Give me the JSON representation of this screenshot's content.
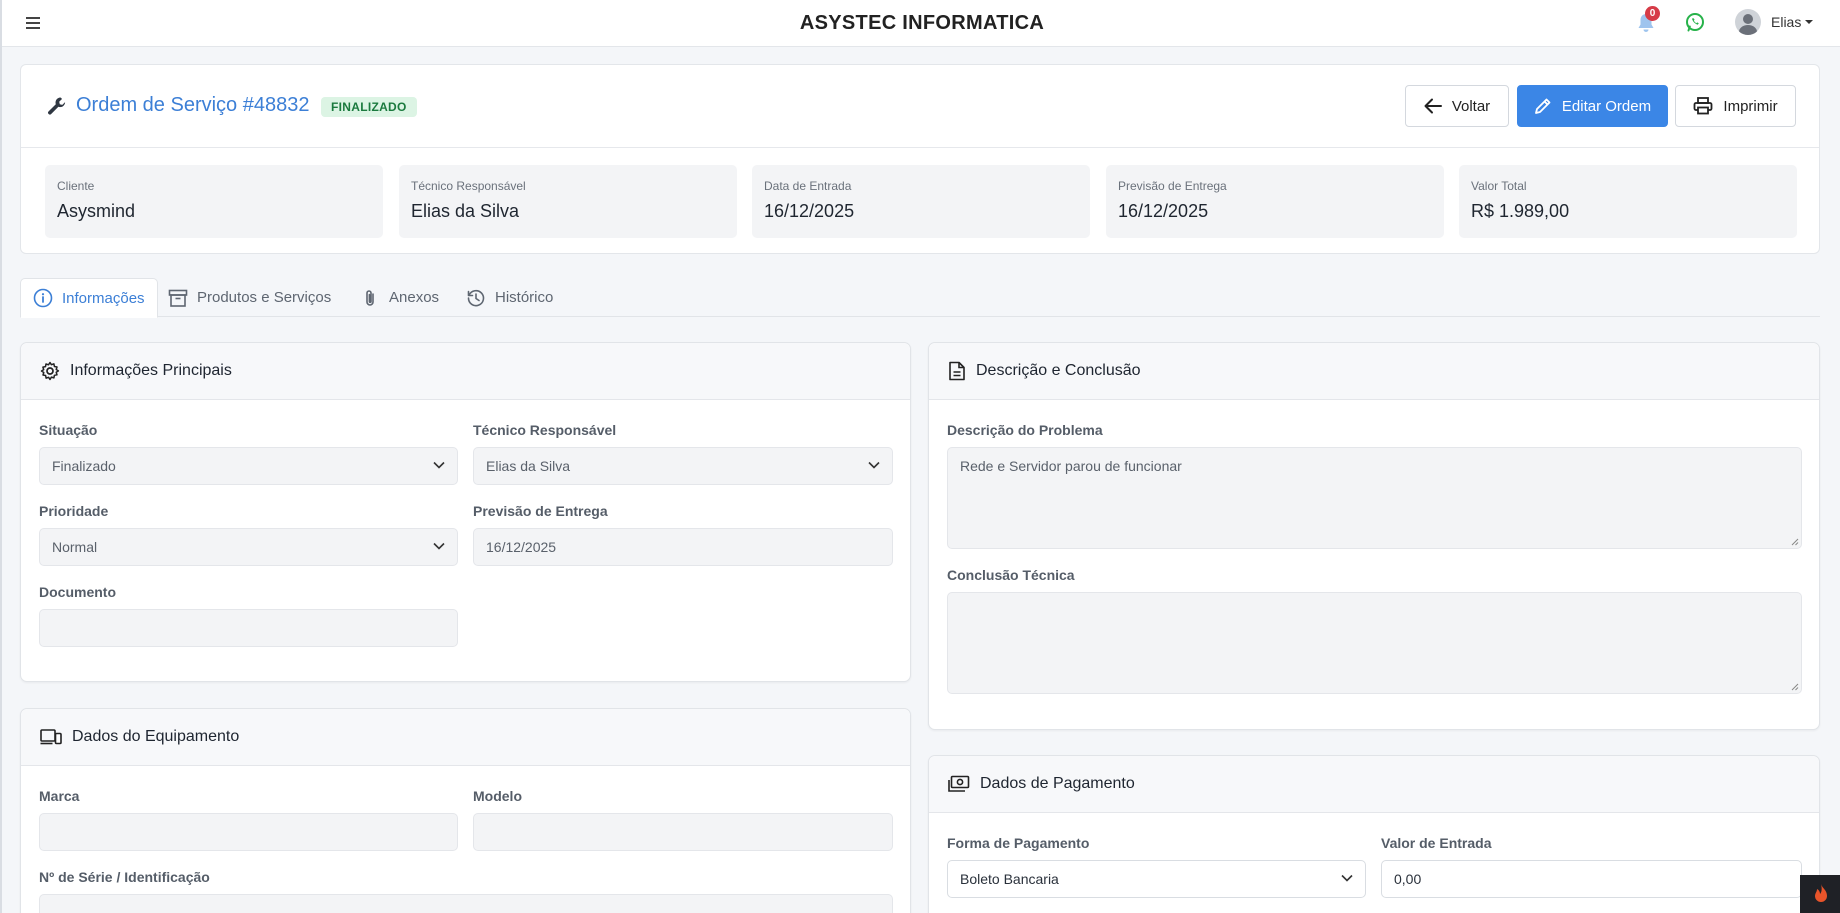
{
  "app": {
    "brand": "ASYSTEC INFORMATICA",
    "notification_count": "0",
    "user_name": "Elias"
  },
  "order": {
    "title": "Ordem de Serviço #48832",
    "status": "FINALIZADO",
    "buttons": {
      "back": "Voltar",
      "edit": "Editar Ordem",
      "print": "Imprimir"
    },
    "stats": [
      {
        "label": "Cliente",
        "value": "Asysmind"
      },
      {
        "label": "Técnico Responsável",
        "value": "Elias da Silva"
      },
      {
        "label": "Data de Entrada",
        "value": "16/12/2025"
      },
      {
        "label": "Previsão de Entrega",
        "value": "16/12/2025"
      },
      {
        "label": "Valor Total",
        "value": "R$ 1.989,00"
      }
    ]
  },
  "tabs": [
    {
      "label": "Informações",
      "icon": "info-icon"
    },
    {
      "label": "Produtos e Serviços",
      "icon": "archive-icon"
    },
    {
      "label": "Anexos",
      "icon": "paperclip-icon"
    },
    {
      "label": "Histórico",
      "icon": "history-icon"
    }
  ],
  "info_panel": {
    "title": "Informações Principais",
    "situacao": {
      "label": "Situação",
      "value": "Finalizado"
    },
    "tecnico": {
      "label": "Técnico Responsável",
      "value": "Elias da Silva"
    },
    "prioridade": {
      "label": "Prioridade",
      "value": "Normal"
    },
    "previsao": {
      "label": "Previsão de Entrega",
      "value": "16/12/2025"
    },
    "documento": {
      "label": "Documento",
      "value": ""
    }
  },
  "equip_panel": {
    "title": "Dados do Equipamento",
    "marca": {
      "label": "Marca",
      "value": ""
    },
    "modelo": {
      "label": "Modelo",
      "value": ""
    },
    "serie": {
      "label": "Nº de Série / Identificação",
      "value": ""
    }
  },
  "desc_panel": {
    "title": "Descrição e Conclusão",
    "problema": {
      "label": "Descrição do Problema",
      "value": "Rede e Servidor parou de funcionar"
    },
    "conclusao": {
      "label": "Conclusão Técnica",
      "value": ""
    }
  },
  "pay_panel": {
    "title": "Dados de Pagamento",
    "forma": {
      "label": "Forma de Pagamento",
      "value": "Boleto Bancaria"
    },
    "entrada": {
      "label": "Valor de Entrada",
      "value": "0,00"
    }
  }
}
